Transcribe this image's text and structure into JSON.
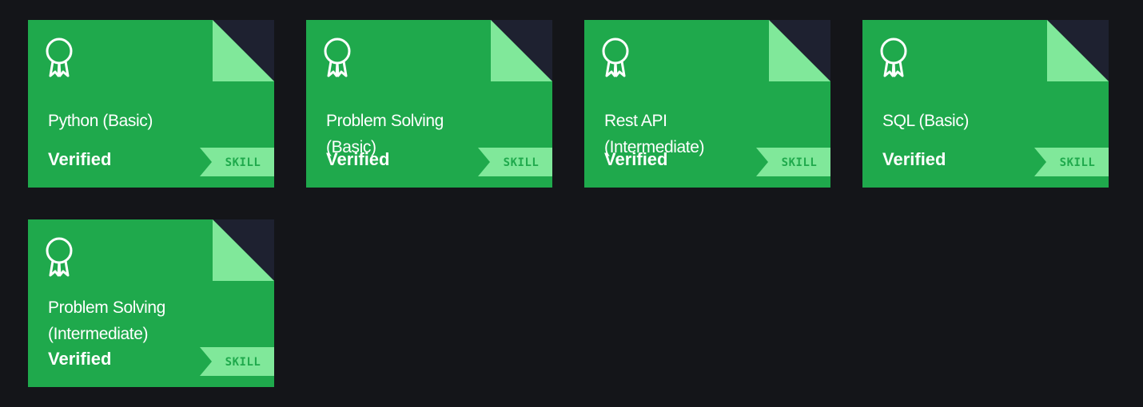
{
  "colors": {
    "background": "#141519",
    "card": "#1fa94c",
    "accent_light": "#80e89a",
    "fold_shadow": "#1e2130"
  },
  "badges": [
    {
      "title": "Python (Basic)",
      "status": "Verified",
      "tag": "SKILL",
      "icon": "award-ribbon-icon"
    },
    {
      "title": "Problem Solving (Basic)",
      "status": "Verified",
      "tag": "SKILL",
      "icon": "award-ribbon-icon"
    },
    {
      "title": "Rest API (Intermediate)",
      "status": "Verified",
      "tag": "SKILL",
      "icon": "award-ribbon-icon"
    },
    {
      "title": "SQL (Basic)",
      "status": "Verified",
      "tag": "SKILL",
      "icon": "award-ribbon-icon"
    },
    {
      "title": "Problem Solving (Intermediate)",
      "status": "Verified",
      "tag": "SKILL",
      "icon": "award-ribbon-icon"
    }
  ]
}
